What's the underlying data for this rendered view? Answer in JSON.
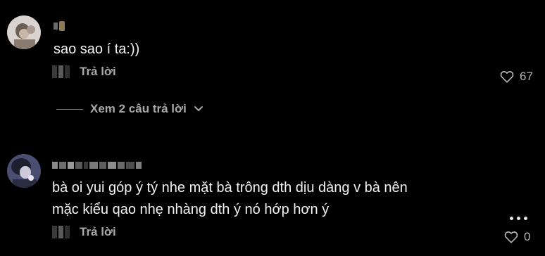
{
  "comments": [
    {
      "text": "sao sao í ta:))",
      "reply_label": "Trả lời",
      "likes": "67",
      "view_replies_label": "Xem 2 câu trả lời"
    },
    {
      "text_line1": "bà oi yui góp ý tý nhe mặt bà trông dth dịu dàng v bà nên",
      "text_line2": "mặc kiểu qao nhẹ nhàng dth ý nó hớp hơn ý",
      "reply_label": "Trả lời",
      "likes": "0"
    }
  ],
  "icons": {
    "like": "heart-outline-icon",
    "more": "more-horizontal-icon",
    "expand": "chevron-down-icon"
  },
  "colors": {
    "background": "#000000",
    "text": "#f2f2f2",
    "secondary_text": "#a8a8a8"
  }
}
